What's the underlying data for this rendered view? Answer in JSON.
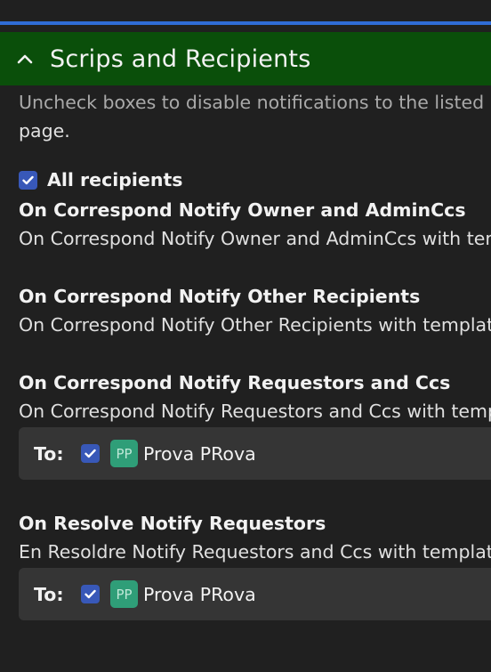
{
  "section": {
    "title": "Scrips and Recipients",
    "intro_line1": "Uncheck boxes to disable notifications to the listed recipients for this transaction only; persistent scrip changes are not saved on this",
    "intro_line2": "page.",
    "all_recipients_label": "All recipients"
  },
  "scrips": [
    {
      "title": "On Correspond Notify Owner and AdminCcs",
      "description": "On Correspond Notify Owner and AdminCcs with template Admin Correspondence"
    },
    {
      "title": "On Correspond Notify Other Recipients",
      "description": "On Correspond Notify Other Recipients with template Correspondence"
    },
    {
      "title": "On Correspond Notify Requestors and Ccs",
      "description": "On Correspond Notify Requestors and Ccs with template Correspondence",
      "to_label": "To:",
      "recipient": {
        "initials": "PP",
        "name": "Prova PRova"
      }
    },
    {
      "title": "On Resolve Notify Requestors",
      "description": "En Resoldre Notify Requestors and Ccs with template Resolved",
      "to_label": "To:",
      "recipient": {
        "initials": "PP",
        "name": "Prova PRova"
      }
    }
  ],
  "colors": {
    "header_bg": "#0a4f0a",
    "accent": "#2f6cd6",
    "checkbox": "#3858b8",
    "avatar": "#2f9e78"
  }
}
